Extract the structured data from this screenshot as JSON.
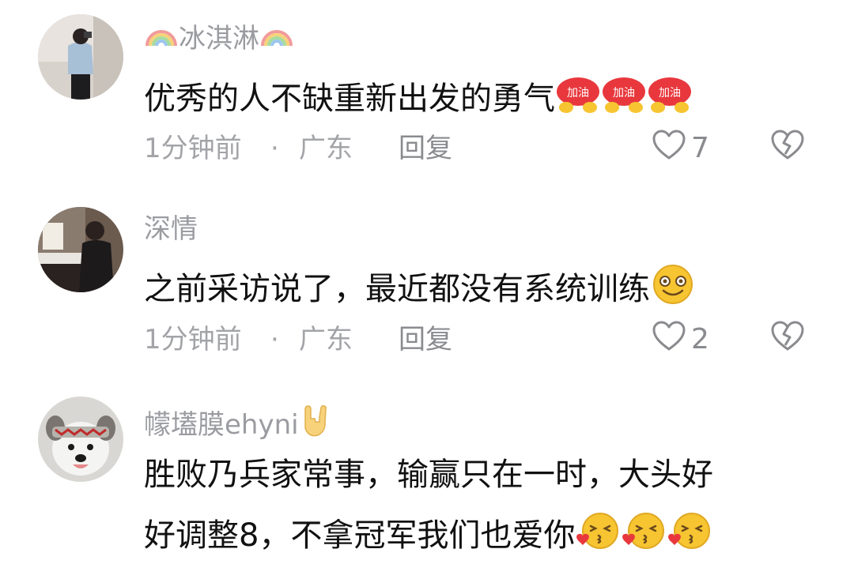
{
  "comments": [
    {
      "username": "冰淇淋",
      "name_prefix_icon": "rainbow-emoji",
      "name_suffix_icon": "rainbow-emoji",
      "text": "优秀的人不缺重新出发的勇气",
      "text_emojis": [
        "jiayou-emoji",
        "jiayou-emoji",
        "jiayou-emoji"
      ],
      "jiayou_label": "加油",
      "time": "1分钟前",
      "separator": "·",
      "location": "广东",
      "reply_label": "回复",
      "like_count": "7"
    },
    {
      "username": "深情",
      "text": "之前采访说了，最近都没有系统训练",
      "text_emojis": [
        "smile-emoji"
      ],
      "time": "1分钟前",
      "separator": "·",
      "location": "广东",
      "reply_label": "回复",
      "like_count": "2"
    },
    {
      "username": "幪壒膜ehyni",
      "name_suffix_icon": "rock-hand-emoji",
      "text_line1": "胜败乃兵家常事，输赢只在一时，大头好",
      "text_line2": "好调整8，不拿冠军我们也爱你",
      "text_emojis": [
        "kiss-emoji",
        "kiss-emoji",
        "kiss-emoji"
      ]
    }
  ],
  "icons": {
    "like": "heart-outline-icon",
    "dislike": "broken-heart-icon"
  },
  "colors": {
    "username": "#9b9ca1",
    "text": "#111111",
    "meta": "#a3a4a8",
    "jiayou_red": "#e8383d",
    "emoji_yellow": "#f7c531"
  }
}
